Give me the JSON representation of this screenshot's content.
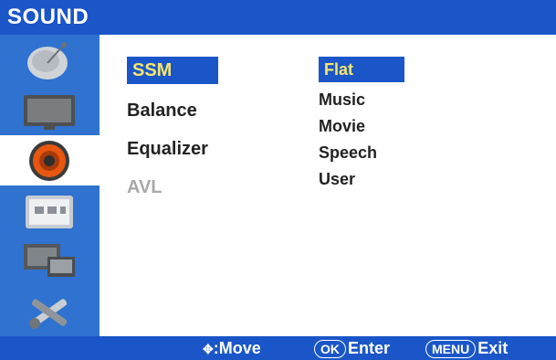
{
  "header": {
    "title": "SOUND"
  },
  "sidebar": {
    "items": [
      {
        "icon": "satellite-dish-icon",
        "selected": false
      },
      {
        "icon": "tv-picture-icon",
        "selected": false
      },
      {
        "icon": "speaker-icon",
        "selected": true
      },
      {
        "icon": "clock-timer-icon",
        "selected": false
      },
      {
        "icon": "pc-monitor-icon",
        "selected": false
      },
      {
        "icon": "wrench-tools-icon",
        "selected": false
      }
    ]
  },
  "menu": {
    "items": [
      {
        "label": "SSM",
        "selected": true
      },
      {
        "label": "Balance",
        "selected": false
      },
      {
        "label": "Equalizer",
        "selected": false
      },
      {
        "label": "AVL",
        "selected": false,
        "disabled": true
      }
    ]
  },
  "options": {
    "items": [
      {
        "label": "Flat",
        "selected": true
      },
      {
        "label": "Music"
      },
      {
        "label": "Movie"
      },
      {
        "label": "Speech"
      },
      {
        "label": "User"
      }
    ]
  },
  "footer": {
    "move_label": ":Move",
    "ok_key": "OK",
    "enter_label": "Enter",
    "menu_key": "MENU",
    "exit_label": "Exit"
  },
  "colors": {
    "accent": "#1a56c8",
    "sidebar": "#2f72cf",
    "highlight_text": "#f7e56b"
  }
}
